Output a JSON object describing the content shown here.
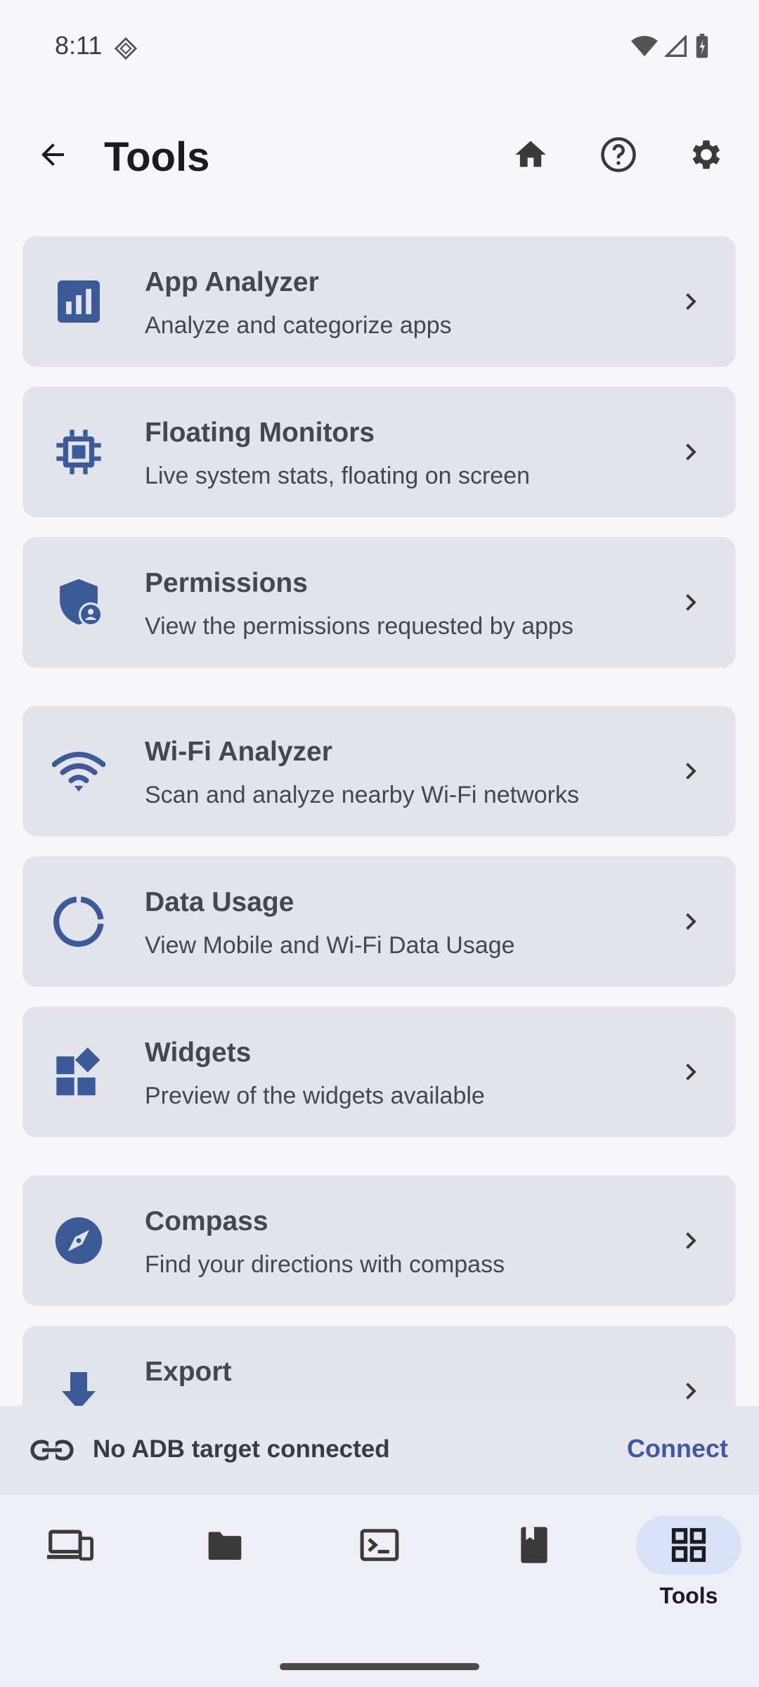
{
  "status_bar": {
    "time": "8:11"
  },
  "app_bar": {
    "title": "Tools"
  },
  "tools": [
    {
      "title": "App Analyzer",
      "description": "Analyze and categorize apps",
      "icon": "bar-chart-icon"
    },
    {
      "title": "Floating Monitors",
      "description": "Live system stats, floating on screen",
      "icon": "cpu-chip-icon"
    },
    {
      "title": "Permissions",
      "description": "View the permissions requested by apps",
      "icon": "shield-person-icon"
    },
    {
      "title": "Wi-Fi Analyzer",
      "description": "Scan and analyze nearby Wi-Fi networks",
      "icon": "wifi-icon"
    },
    {
      "title": "Data Usage",
      "description": "View Mobile and Wi-Fi Data Usage",
      "icon": "data-usage-icon"
    },
    {
      "title": "Widgets",
      "description": "Preview of the widgets available",
      "icon": "widgets-icon"
    },
    {
      "title": "Compass",
      "description": "Find your directions with compass",
      "icon": "compass-icon"
    },
    {
      "title": "Export",
      "description": "",
      "icon": "download-icon"
    }
  ],
  "adb_bar": {
    "status": "No ADB target connected",
    "action": "Connect"
  },
  "bottom_nav": {
    "active_label": "Tools"
  },
  "colors": {
    "accent": "#3f5aa0",
    "card": "#e3e3ec",
    "icon": "#3d5a98"
  }
}
